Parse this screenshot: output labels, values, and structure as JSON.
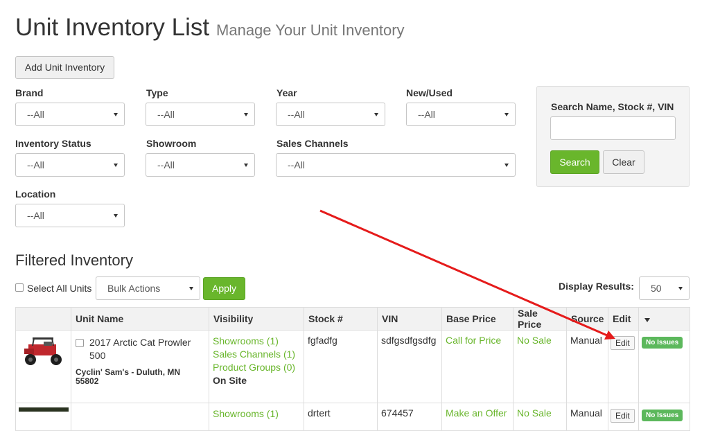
{
  "page": {
    "title": "Unit Inventory List",
    "subtitle": "Manage Your Unit Inventory"
  },
  "toolbar": {
    "add_label": "Add Unit Inventory"
  },
  "filters": {
    "brand": {
      "label": "Brand",
      "value": "--All"
    },
    "type": {
      "label": "Type",
      "value": "--All"
    },
    "year": {
      "label": "Year",
      "value": "--All"
    },
    "new_used": {
      "label": "New/Used",
      "value": "--All"
    },
    "inventory_status": {
      "label": "Inventory Status",
      "value": "--All"
    },
    "showroom": {
      "label": "Showroom",
      "value": "--All"
    },
    "sales_channels": {
      "label": "Sales Channels",
      "value": "--All"
    },
    "location": {
      "label": "Location",
      "value": "--All"
    }
  },
  "search": {
    "label": "Search Name, Stock #, VIN",
    "value": "",
    "search_label": "Search",
    "clear_label": "Clear"
  },
  "filtered": {
    "title": "Filtered Inventory",
    "select_all_label": "Select All Units",
    "bulk_actions": "Bulk Actions",
    "apply_label": "Apply",
    "display_results_label": "Display Results:",
    "display_results_value": "50"
  },
  "table": {
    "headers": {
      "unit_name": "Unit Name",
      "visibility": "Visibility",
      "stock": "Stock #",
      "vin": "VIN",
      "base_price": "Base Price",
      "sale_price": "Sale Price",
      "source": "Source",
      "edit": "Edit"
    },
    "rows": [
      {
        "unit_name": "2017 Arctic Cat Prowler 500",
        "dealer": "Cyclin' Sam's - Duluth, MN 55802",
        "showrooms": "Showrooms (1)",
        "sales_channels": "Sales Channels (1)",
        "product_groups": "Product Groups (0)",
        "status": "On Site",
        "stock": "fgfadfg",
        "vin": "sdfgsdfgsdfg",
        "base_price": "Call for Price",
        "sale_price": "No Sale",
        "source": "Manual",
        "edit_label": "Edit",
        "badge": "No Issues"
      },
      {
        "showrooms": "Showrooms (1)",
        "stock": "drtert",
        "vin": "674457",
        "base_price": "Make an Offer",
        "sale_price": "No Sale",
        "source": "Manual",
        "edit_label": "Edit",
        "badge": "No Issues"
      }
    ]
  },
  "colors": {
    "accent_green": "#69b62c",
    "badge_green": "#5cb85c",
    "annotation_arrow": "#e51b1b"
  }
}
